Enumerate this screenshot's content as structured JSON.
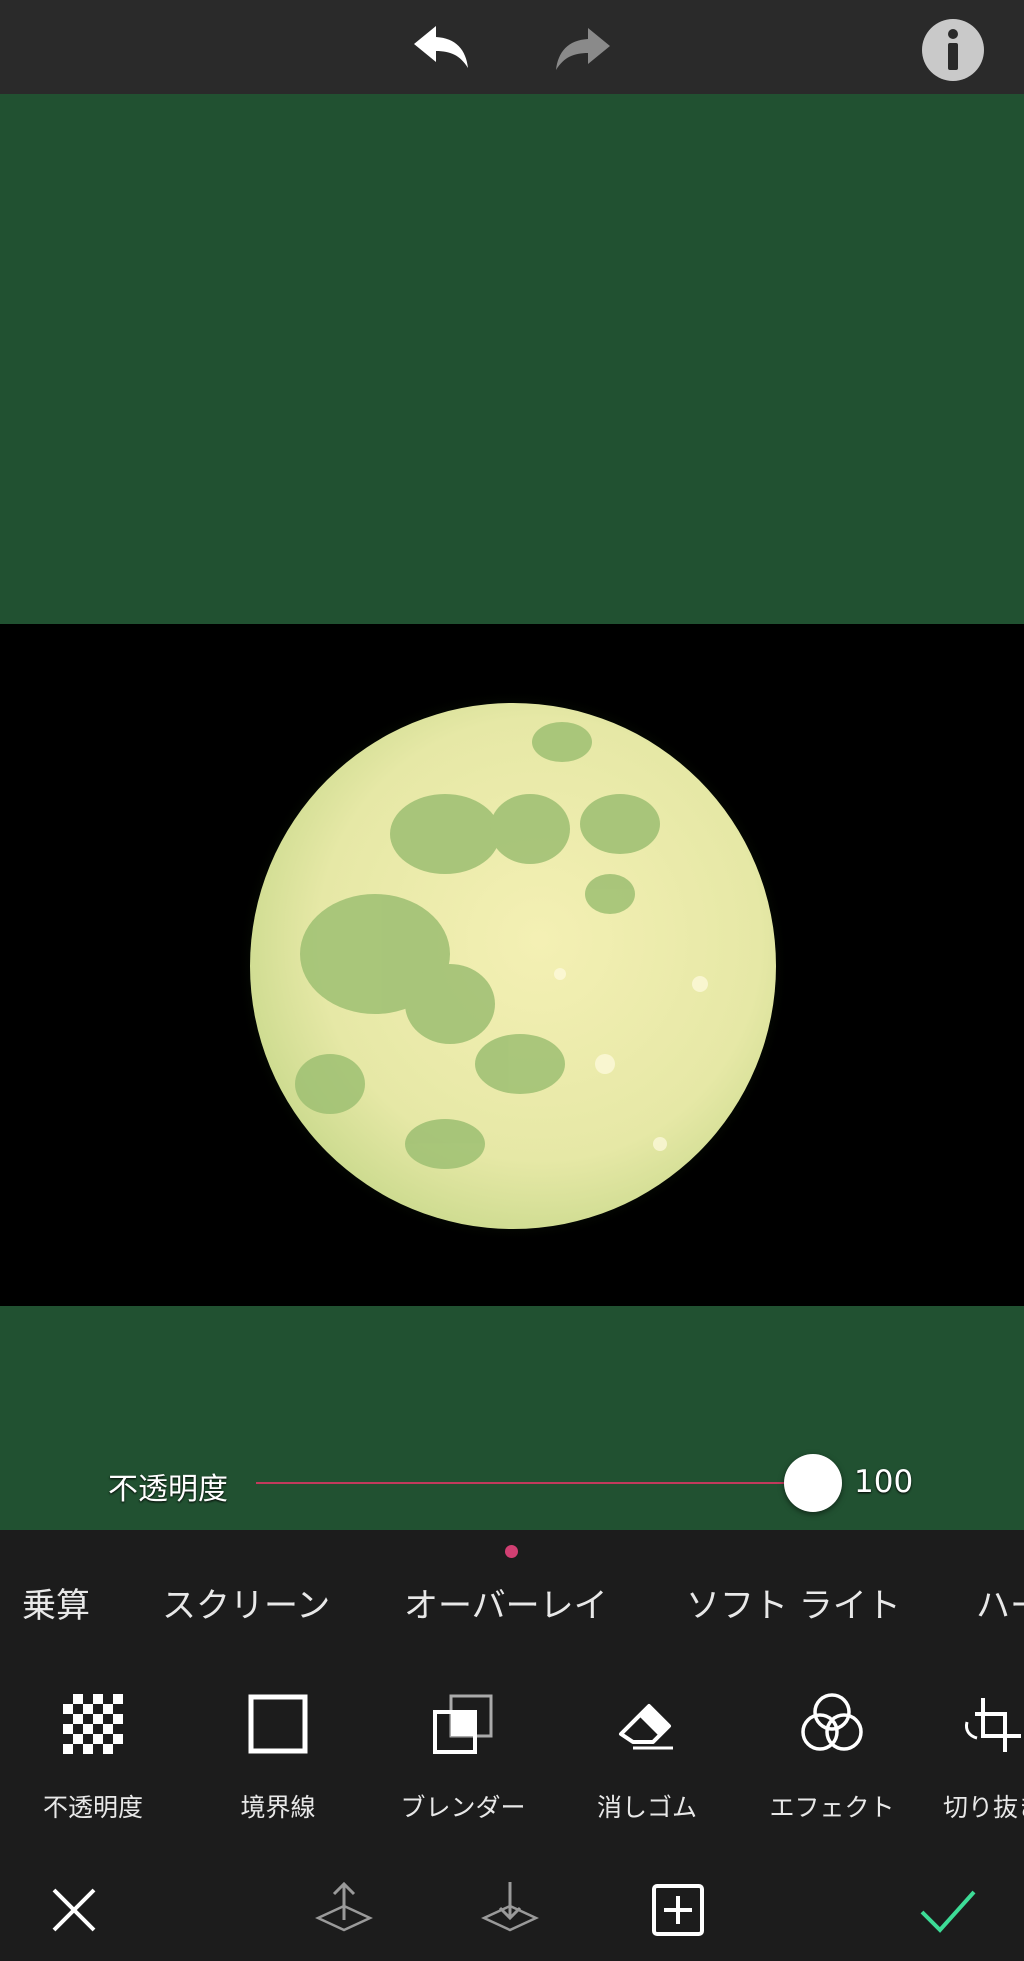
{
  "toolbar": {
    "undo_icon": "undo-arrow",
    "redo_icon": "redo-arrow",
    "info_icon": "info-circle"
  },
  "canvas": {
    "background_color": "#215131",
    "photo_subject": "full moon"
  },
  "opacity_slider": {
    "label": "不透明度",
    "value": "100",
    "level": 1.0,
    "track_color": "#c23a5c"
  },
  "blend_modes": {
    "items": [
      "乗算",
      "スクリーン",
      "オーバーレイ",
      "ソフト ライト",
      "ハー"
    ],
    "indicator_color": "#d13f72"
  },
  "tools": {
    "items": [
      {
        "label": "不透明度",
        "icon": "checkerboard-icon"
      },
      {
        "label": "境界線",
        "icon": "square-outline-icon"
      },
      {
        "label": "ブレンダー",
        "icon": "layers-icon"
      },
      {
        "label": "消しゴム",
        "icon": "eraser-icon"
      },
      {
        "label": "エフェクト",
        "icon": "circles-icon"
      },
      {
        "label": "切り抜き",
        "icon": "crop-icon"
      }
    ]
  },
  "bottom_bar": {
    "cancel_icon": "close-x",
    "move_up_icon": "layer-up",
    "move_down_icon": "layer-down",
    "add_icon": "plus-box",
    "confirm_icon": "checkmark",
    "confirm_color": "#3ddc97"
  }
}
